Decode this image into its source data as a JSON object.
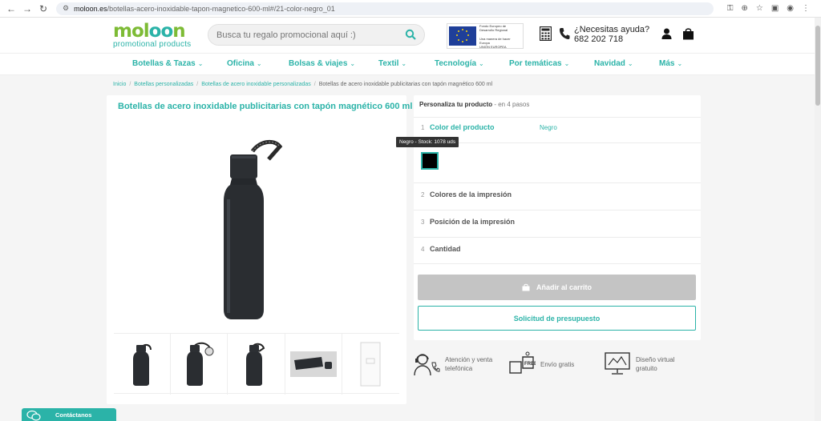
{
  "browser": {
    "url_host": "moloon.es",
    "url_path": "/botellas-acero-inoxidable-tapon-magnetico-600-ml#/21-color-negro_01"
  },
  "header": {
    "logo_word_1": "mol",
    "logo_word_2": "oo",
    "logo_word_3": "n",
    "logo_sub": "promotional products",
    "search_placeholder": "Busca tu regalo promocional aquí :)",
    "eu_text": "Fondo Europeo de Desarrollo Regional",
    "eu_text_2": "Una manera de hacer Europa",
    "eu_label": "UNIÓN EUROPEA",
    "help_label": "¿Necesitas ayuda?",
    "phone": "682 202 718"
  },
  "menu": [
    {
      "label": "Botellas & Tazas"
    },
    {
      "label": "Oficina"
    },
    {
      "label": "Bolsas & viajes"
    },
    {
      "label": "Textil"
    },
    {
      "label": "Tecnología"
    },
    {
      "label": "Por temáticas"
    },
    {
      "label": "Navidad"
    },
    {
      "label": "Más"
    }
  ],
  "breadcrumb": {
    "items": [
      "Inicio",
      "Botellas personalizadas",
      "Botellas de acero inoxidable personalizadas"
    ],
    "current": "Botellas de acero inoxidable publicitarias con tapón magnético 600 ml"
  },
  "product": {
    "title": "Botellas de acero inoxidable publicitarias con tapón magnético 600 ml"
  },
  "configurator": {
    "heading": "Personaliza tu producto",
    "heading_steps": " - en 4 pasos",
    "steps": [
      {
        "num": "1",
        "label": "Color del producto",
        "value": "Negro"
      },
      {
        "num": "2",
        "label": "Colores de la impresión"
      },
      {
        "num": "3",
        "label": "Posición de la impresión"
      },
      {
        "num": "4",
        "label": "Cantidad"
      }
    ],
    "swatch_tooltip": "Negro - Stock: 1078 uds",
    "swatch_color": "#000000",
    "cart_label": "Añadir al carrito",
    "quote_label": "Solicitud de presupuesto"
  },
  "features": [
    {
      "text": "Atención y venta telefónica",
      "icon": "phone-support-icon"
    },
    {
      "text": "Envío gratis",
      "icon": "free-shipping-icon"
    },
    {
      "text": "Diseño virtual gratuito",
      "icon": "virtual-design-icon"
    }
  ],
  "contact": {
    "label": "Contáctanos"
  },
  "colors": {
    "accent": "#2bb3a8",
    "logo_green": "#7dbb35",
    "disabled": "#c4c4c4"
  }
}
